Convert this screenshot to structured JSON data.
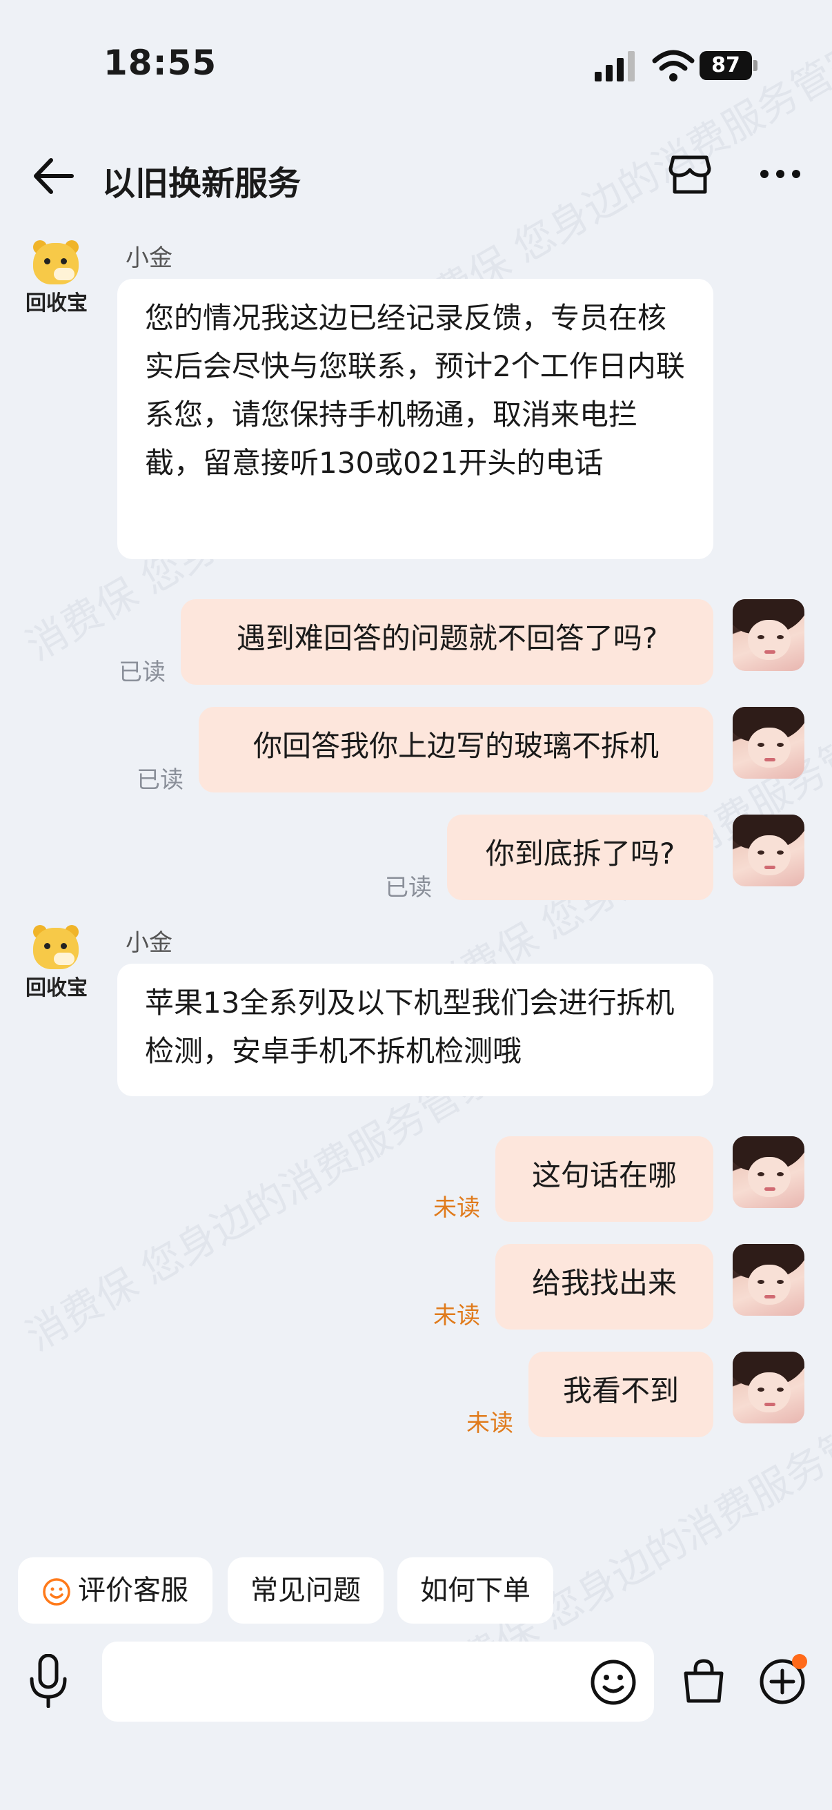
{
  "status_bar": {
    "time": "18:55",
    "battery": "87"
  },
  "header": {
    "title": "以旧换新服务"
  },
  "bot": {
    "name": "小金",
    "brand": "回收宝"
  },
  "messages": {
    "m1": "您的情况我这边已经记录反馈，专员在核实后会尽快与您联系，预计2个工作日内联系您，请您保持手机畅通，取消来电拦截，留意接听130或021开头的电话",
    "m2": "遇到难回答的问题就不回答了吗?",
    "m3": "你回答我你上边写的玻璃不拆机",
    "m4": "你到底拆了吗?",
    "m5": "苹果13全系列及以下机型我们会进行拆机检测，安卓手机不拆机检测哦",
    "m6": "这句话在哪",
    "m7": "给我找出来",
    "m8": "我看不到"
  },
  "receipts": {
    "read": "已读",
    "unread": "未读"
  },
  "quick_replies": [
    "评价客服",
    "常见问题",
    "如何下单"
  ],
  "input": {
    "value": "",
    "placeholder": ""
  },
  "watermark": "消费保 您身边的消费服务管家",
  "colors": {
    "background": "#eef1f6",
    "user_bubble": "#fde6dc",
    "unread": "#e07b1c",
    "accent": "#ff6a1a"
  }
}
